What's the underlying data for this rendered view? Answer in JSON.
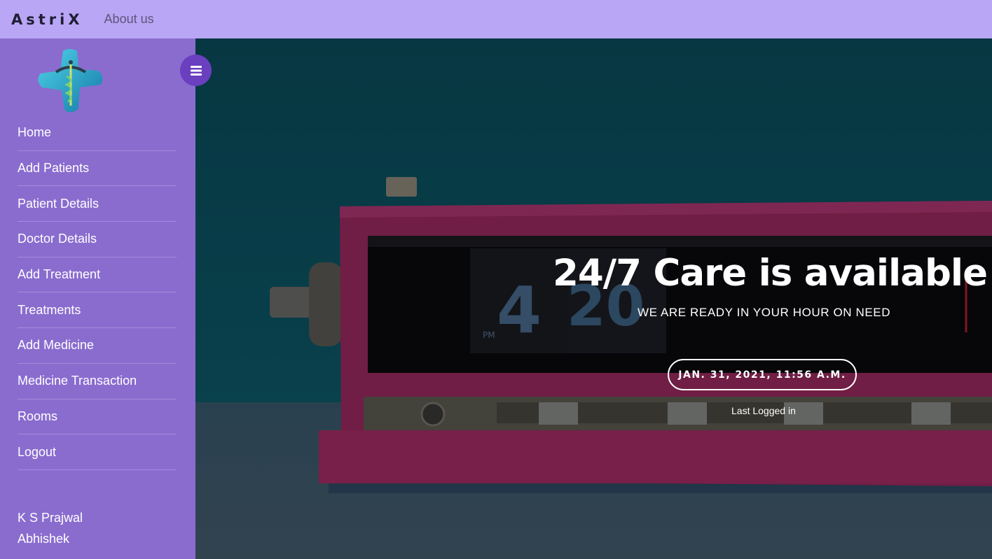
{
  "topbar": {
    "brand": "AstriX",
    "about_label": "About us"
  },
  "sidebar": {
    "items": [
      {
        "label": "Home"
      },
      {
        "label": "Add Patients"
      },
      {
        "label": "Patient Details"
      },
      {
        "label": "Doctor Details"
      },
      {
        "label": "Add Treatment"
      },
      {
        "label": "Treatments"
      },
      {
        "label": "Add Medicine"
      },
      {
        "label": "Medicine Transaction"
      },
      {
        "label": "Rooms"
      },
      {
        "label": "Logout"
      }
    ],
    "users": [
      "K S Prajwal",
      "Abhishek"
    ],
    "toggle_icon": "hamburger-menu-icon",
    "logo_icon": "medical-cross-caduceus-logo"
  },
  "hero": {
    "headline": "24/7 Care is available",
    "subline": "WE ARE READY IN YOUR HOUR ON NEED",
    "datetime": "JAN. 31, 2021, 11:56 A.M.",
    "last_logged": "Last Logged in",
    "clock_digits": {
      "hour": "4",
      "minute": "20",
      "pm": "PM"
    }
  },
  "colors": {
    "topbar": "#b9a6f5",
    "sidebar": "#8a6ccf",
    "toggle": "#6a3fc0",
    "hero_bg": "#0b5566",
    "clock_body": "#c2306f"
  }
}
